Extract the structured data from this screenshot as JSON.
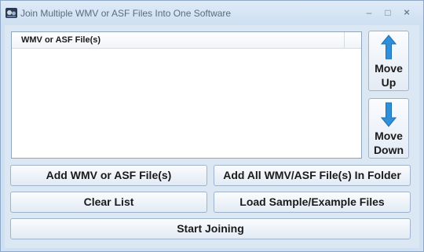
{
  "window": {
    "title": "Join Multiple WMV or ASF Files Into One Software",
    "controls": {
      "minimize": "–",
      "maximize": "□",
      "close": "×"
    }
  },
  "file_list": {
    "column_header": "WMV or ASF File(s)",
    "rows": []
  },
  "side_buttons": {
    "move_up": {
      "line1": "Move",
      "line2": "Up",
      "icon": "arrow-up-icon"
    },
    "move_down": {
      "line1": "Move",
      "line2": "Down",
      "icon": "arrow-down-icon"
    }
  },
  "buttons": {
    "add_files": "Add WMV or ASF File(s)",
    "add_folder": "Add All WMV/ASF File(s) In Folder",
    "clear_list": "Clear List",
    "load_sample": "Load Sample/Example Files",
    "start_joining": "Start Joining"
  },
  "colors": {
    "window_bg": "#dce7f4",
    "arrow_blue": "#2f8fd8"
  }
}
